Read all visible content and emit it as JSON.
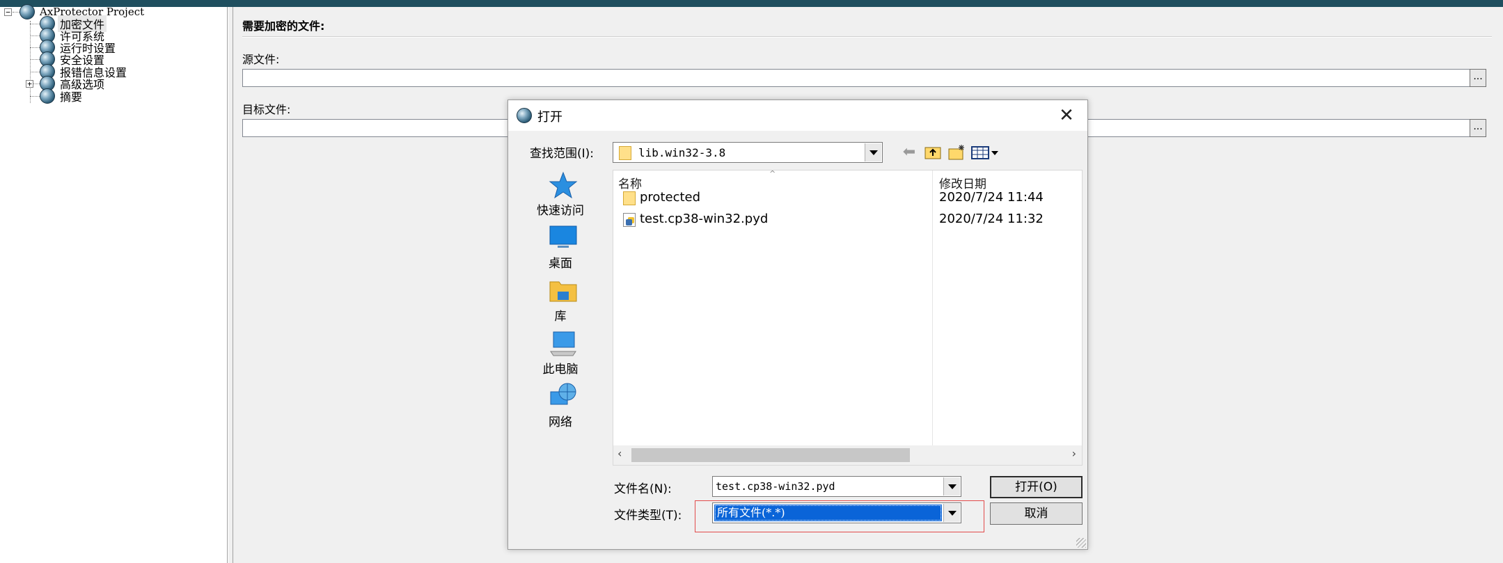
{
  "tree": {
    "root": "AxProtector Project",
    "items": [
      {
        "label": "加密文件",
        "selected": true
      },
      {
        "label": "许可系统"
      },
      {
        "label": "运行时设置"
      },
      {
        "label": "安全设置"
      },
      {
        "label": "报错信息设置"
      },
      {
        "label": "高级选项",
        "expander": "+"
      },
      {
        "label": "摘要"
      }
    ],
    "root_expander": "−"
  },
  "main": {
    "header": "需要加密的文件:",
    "source_label": "源文件:",
    "target_label": "目标文件:",
    "browse_label": "..."
  },
  "dialog": {
    "title": "打开",
    "close_glyph": "✕",
    "lookin_label": "查找范围(I):",
    "lookin_value": "lib.win32-3.8",
    "places": [
      {
        "label": "快速访问",
        "icon": "star-icon"
      },
      {
        "label": "桌面",
        "icon": "desktop-icon"
      },
      {
        "label": "库",
        "icon": "library-folder-icon"
      },
      {
        "label": "此电脑",
        "icon": "computer-icon"
      },
      {
        "label": "网络",
        "icon": "network-globe-icon"
      }
    ],
    "columns": {
      "name": "名称",
      "date": "修改日期"
    },
    "files": [
      {
        "name": "protected",
        "date": "2020/7/24 11:44",
        "type": "folder"
      },
      {
        "name": "test.cp38-win32.pyd",
        "date": "2020/7/24 11:32",
        "type": "pyd"
      }
    ],
    "filename_label": "文件名(N):",
    "filename_value": "test.cp38-win32.pyd",
    "filetype_label": "文件类型(T):",
    "filetype_value": "所有文件(*.*)",
    "open_button": "打开(O)",
    "cancel_button": "取消",
    "highlight_color": "#e24a4a",
    "selection_color": "#0a64d8"
  }
}
